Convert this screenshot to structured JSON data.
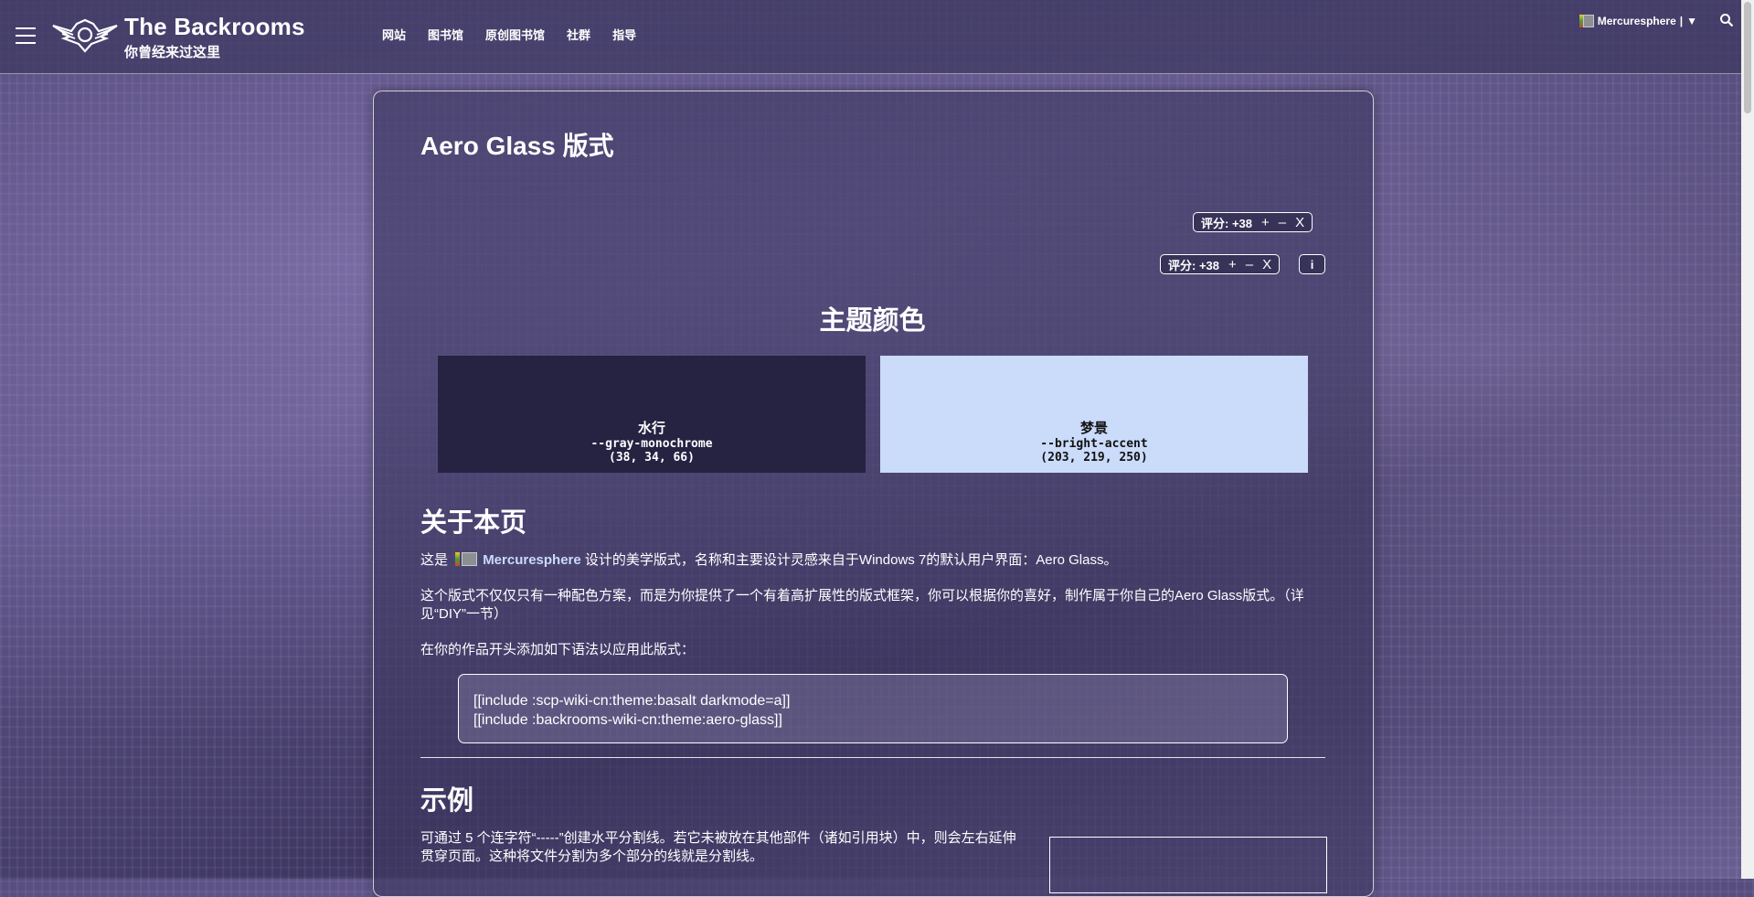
{
  "header": {
    "site_title": "The Backrooms",
    "site_subtitle": "你曾经来过这里",
    "nav": [
      "网站",
      "图书馆",
      "原创图书馆",
      "社群",
      "指导"
    ],
    "user": {
      "name": "Mercuresphere",
      "separator": "|",
      "menu": "▼"
    }
  },
  "page": {
    "title": "Aero Glass 版式",
    "rating1": {
      "label": "评分: +38",
      "up": "+",
      "down": "–",
      "cancel": "X"
    },
    "rating2": {
      "label": "评分: +38",
      "up": "+",
      "down": "–",
      "cancel": "X",
      "info": "i"
    },
    "theme_colors_heading": "主题颜色",
    "swatches": [
      {
        "name": "水行",
        "var": "--gray-monochrome",
        "rgb": "(38, 34, 66)",
        "color": "#262242"
      },
      {
        "name": "梦景",
        "var": "--bright-accent",
        "rgb": "(203, 219, 250)",
        "color": "#cbdbfa"
      }
    ],
    "about_heading": "关于本页",
    "about_p1_prefix": "这是",
    "about_p1_user": "Mercuresphere",
    "about_p1_suffix": "设计的美学版式，名称和主要设计灵感来自于Windows 7的默认用户界面：Aero Glass。",
    "about_p2": "这个版式不仅仅只有一种配色方案，而是为你提供了一个有着高扩展性的版式框架，你可以根据你的喜好，制作属于你自己的Aero Glass版式。（详见“DIY”一节）",
    "about_p3": "在你的作品开头添加如下语法以应用此版式：",
    "code_line1": "[[include :scp-wiki-cn:theme:basalt darkmode=a]]",
    "code_line2": "[[include :backrooms-wiki-cn:theme:aero-glass]]",
    "example_heading": "示例",
    "example_p": "可通过 5 个连字符“-----”创建水平分割线。若它未被放在其他部件（诸如引用块）中，则会左右延伸贯穿页面。这种将文件分割为多个部分的线就是分割线。"
  }
}
